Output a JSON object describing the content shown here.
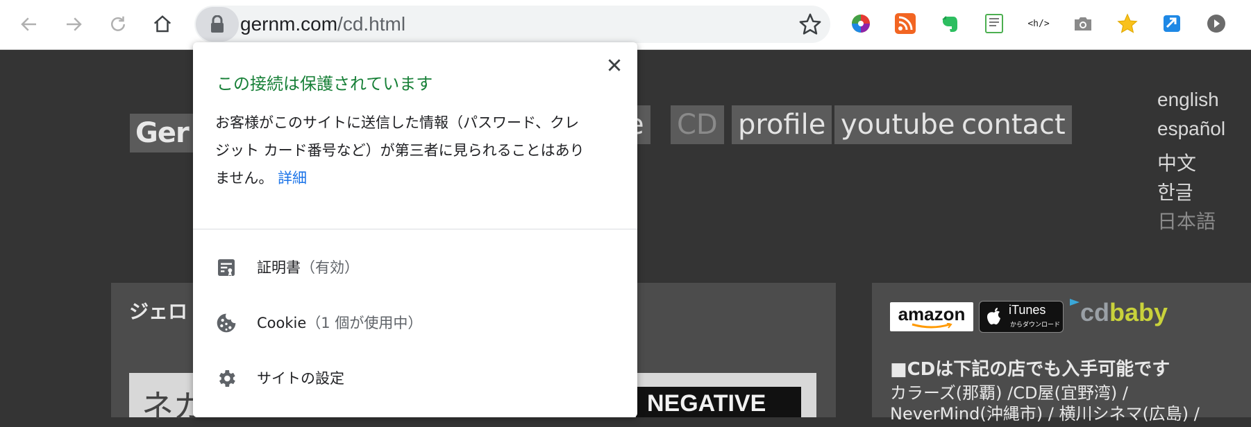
{
  "browser": {
    "url_host": "gernm.com",
    "url_path": "/cd.html",
    "extensions": [
      "color-picker-icon",
      "rss-icon",
      "evernote-icon",
      "html5-outline-icon",
      "code-tag-icon",
      "camera-icon",
      "bookmark-star-icon",
      "tab-manager-icon",
      "play-circle-icon"
    ],
    "code_tag_text": "<h/>"
  },
  "site": {
    "logo_text": "Ger",
    "nav": [
      {
        "label": "e"
      },
      {
        "label": "CD"
      },
      {
        "label": "profile"
      },
      {
        "label": "youtube"
      },
      {
        "label": "contact"
      }
    ],
    "languages": [
      "english",
      "español",
      "中文",
      "한글",
      "日本語"
    ],
    "main_heading": "ジェロ",
    "cover_text": "ネガ",
    "negative_text": "NEGATIVE",
    "stores": {
      "amazon": "amazon",
      "itunes": "iTunes",
      "itunes_sub": "からダウンロード",
      "cdbaby_cd": "cd",
      "cdbaby_baby": "baby"
    },
    "side_title": "■CDは下記の店でも入手可能です",
    "side_lines": [
      "カラーズ(那覇) /CD屋(宜野湾) /",
      "NeverMind(沖縄市) / 横川シネマ(広島) /"
    ]
  },
  "popup": {
    "title": "この接続は保護されています",
    "desc_line1": "お客様がこのサイトに送信した情報（パスワード、クレ",
    "desc_line2": "ジット カード番号など）が第三者に見られることはあり",
    "desc_line3": "ません。",
    "details_link": "詳細",
    "certificate_label": "証明書",
    "certificate_status": "（有効）",
    "cookie_label": "Cookie",
    "cookie_status": "（1 個が使用中）",
    "site_settings_label": "サイトの設定"
  },
  "colors": {
    "secure_green": "#188038",
    "link_blue": "#1a73e8",
    "page_bg": "#343434"
  }
}
